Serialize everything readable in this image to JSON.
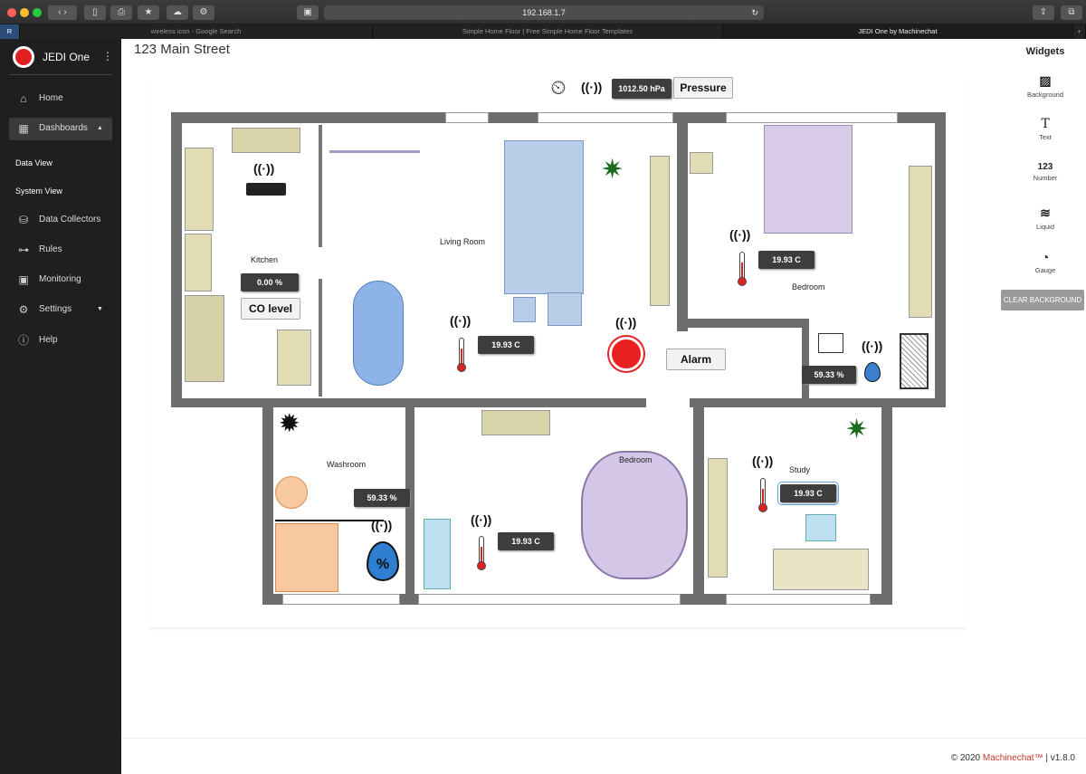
{
  "browser": {
    "url": "192.168.1.7",
    "tabs": [
      {
        "label": "wireless icon - Google Search"
      },
      {
        "label": "Simple Home Floor | Free Simple Home Floor Templates"
      },
      {
        "label": "JEDI One by Machinechat"
      }
    ],
    "traffic_colors": [
      "#ff5f57",
      "#febc2e",
      "#28c840"
    ]
  },
  "sidebar": {
    "brand": "JEDI One",
    "items": [
      {
        "label": "Home",
        "icon": "home-icon"
      },
      {
        "label": "Dashboards",
        "icon": "dashboard-icon"
      },
      {
        "label": "Data View"
      },
      {
        "label": "System View"
      },
      {
        "label": "Data Collectors",
        "icon": "cubes-icon"
      },
      {
        "label": "Rules",
        "icon": "rules-icon"
      },
      {
        "label": "Monitoring",
        "icon": "monitor-icon"
      },
      {
        "label": "Settings",
        "icon": "gear-icon"
      },
      {
        "label": "Help",
        "icon": "help-icon"
      }
    ]
  },
  "page": {
    "title": "123 Main Street"
  },
  "plan": {
    "rooms": {
      "kitchen": "Kitchen",
      "living": "Living Room",
      "bedroom1": "Bedroom",
      "washroom": "Washroom",
      "bedroom2": "Bedroom",
      "study": "Study"
    },
    "pressure": {
      "value": "1012.50 hPa",
      "label": "Pressure"
    },
    "co": {
      "value": "0.00 %",
      "label": "CO level"
    },
    "alarm": {
      "label": "Alarm"
    },
    "temps": {
      "living": "19.93 C",
      "bedroom1": "19.93 C",
      "bedroom2": "19.93 C",
      "study": "19.93 C"
    },
    "humidity": {
      "bath": "59.33 %",
      "washroom": "59.33 %"
    }
  },
  "widgets": {
    "title": "Widgets",
    "items": [
      {
        "label": "Background",
        "icon": "image-icon"
      },
      {
        "label": "Text",
        "icon": "T"
      },
      {
        "label": "Number",
        "icon": "123"
      },
      {
        "label": "Liquid",
        "icon": "waves-icon"
      },
      {
        "label": "Gauge",
        "icon": "gauge-icon"
      }
    ],
    "clear_label": "CLEAR BACKGROUND"
  },
  "footer": {
    "copyright": "© 2020 ",
    "brand": "Machinechat™",
    "version": " | v1.8.0"
  },
  "colors": {
    "sidebar": "#1f1f1f",
    "accent": "#c0392b",
    "wall": "#6d6d6d"
  }
}
